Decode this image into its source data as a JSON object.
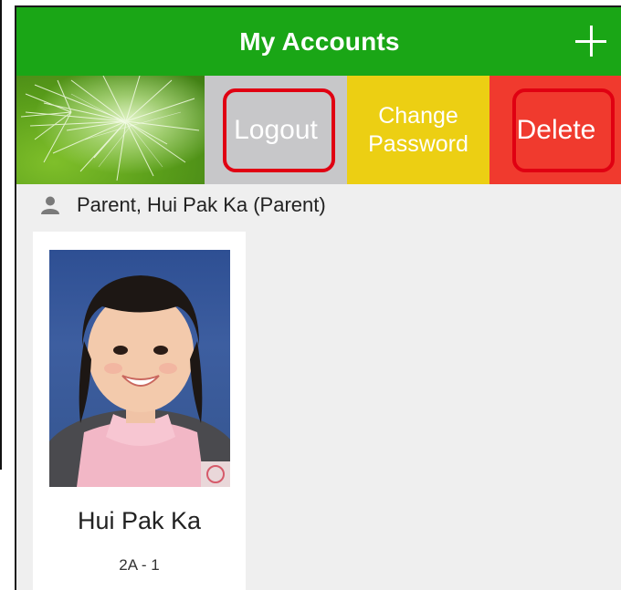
{
  "header": {
    "title": "My Accounts",
    "add_icon": "plus-icon",
    "background_color": "#1aa616"
  },
  "account_actions": {
    "logout_label": "Logout",
    "change_password_label": "Change\nPassword",
    "delete_label": "Delete",
    "colors": {
      "logout": "#c7c7c9",
      "change_password": "#eccf13",
      "delete": "#f03a2e",
      "highlight": "#e00012"
    }
  },
  "user": {
    "icon": "person-icon",
    "label": "Parent, Hui Pak Ka (Parent)"
  },
  "students": [
    {
      "name": "Hui Pak Ka",
      "class_label": "2A - 1"
    }
  ]
}
